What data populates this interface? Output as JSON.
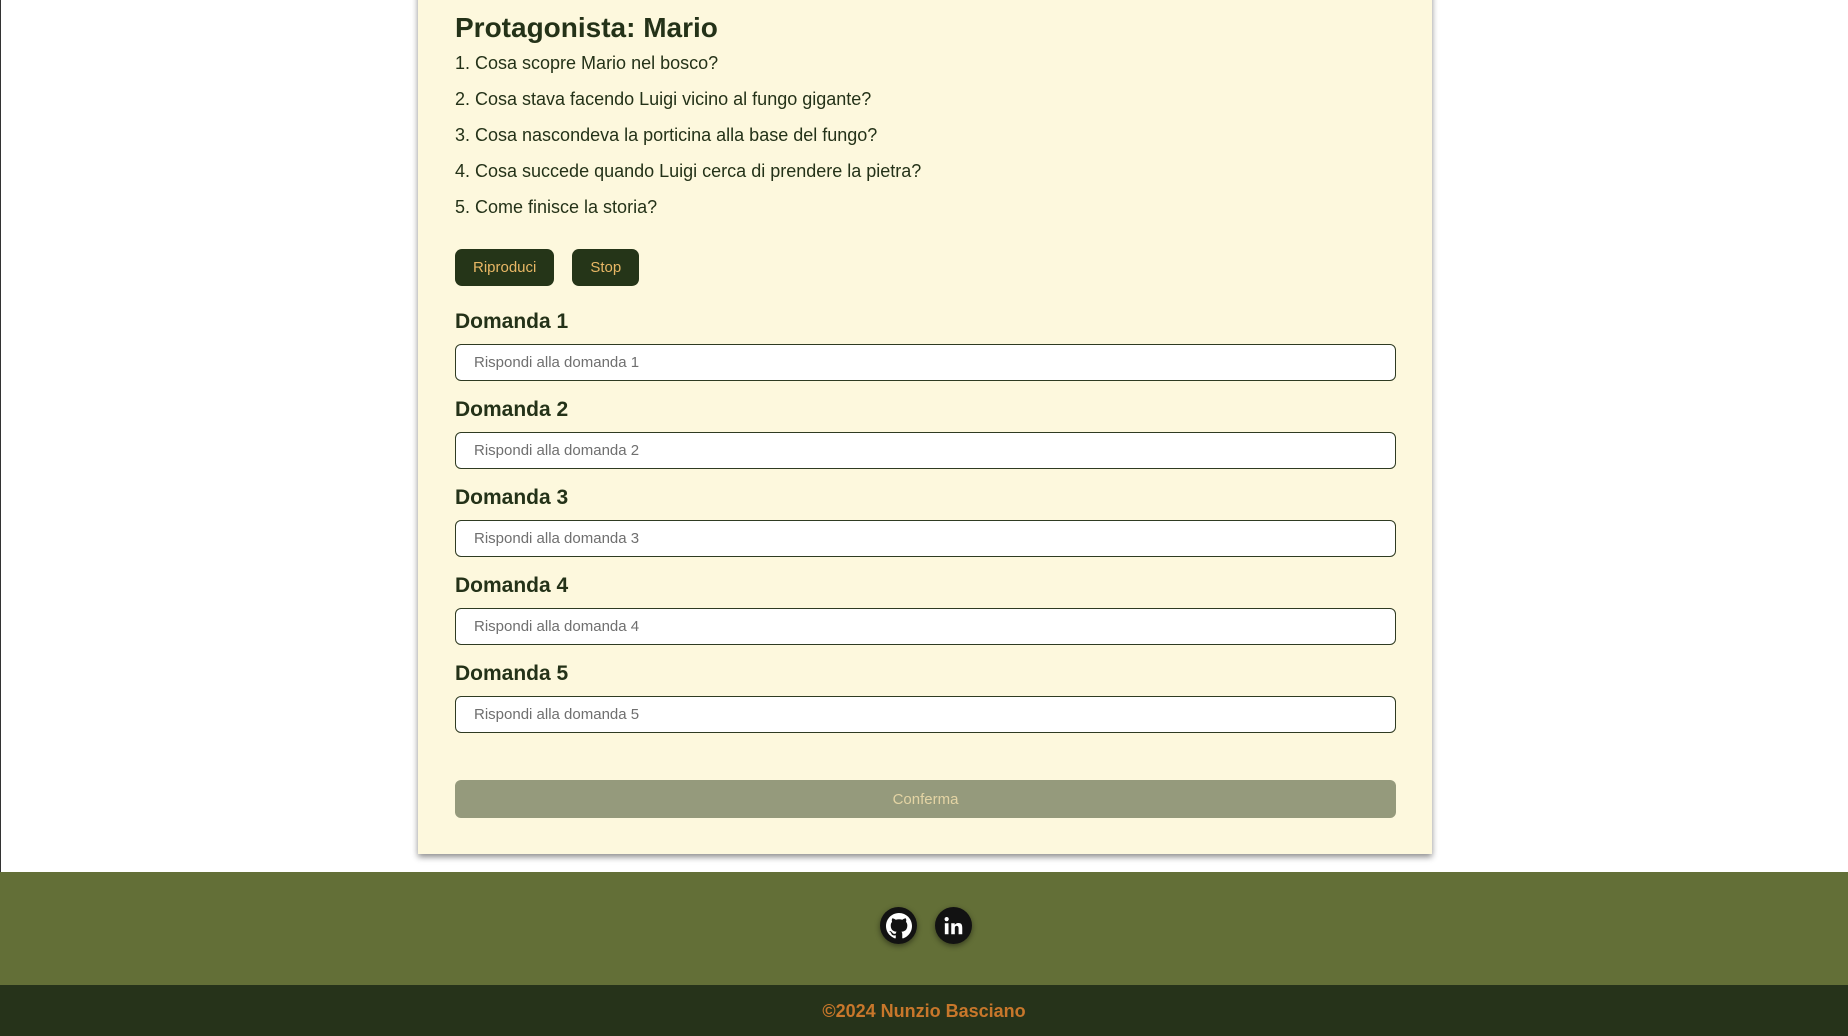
{
  "story": {
    "title": "Protagonista: Mario",
    "questions": [
      "1. Cosa scopre Mario nel bosco?",
      "2. Cosa stava facendo Luigi vicino al fungo gigante?",
      "3. Cosa nascondeva la porticina alla base del fungo?",
      "4. Cosa succede quando Luigi cerca di prendere la pietra?",
      "5. Come finisce la storia?"
    ],
    "play_label": "Riproduci",
    "stop_label": "Stop"
  },
  "answers": [
    {
      "label": "Domanda 1",
      "placeholder": "Rispondi alla domanda 1",
      "value": ""
    },
    {
      "label": "Domanda 2",
      "placeholder": "Rispondi alla domanda 2",
      "value": ""
    },
    {
      "label": "Domanda 3",
      "placeholder": "Rispondi alla domanda 3",
      "value": ""
    },
    {
      "label": "Domanda 4",
      "placeholder": "Rispondi alla domanda 4",
      "value": ""
    },
    {
      "label": "Domanda 5",
      "placeholder": "Rispondi alla domanda 5",
      "value": ""
    }
  ],
  "confirm_label": "Conferma",
  "footer": {
    "social": [
      {
        "icon": "github-icon"
      },
      {
        "icon": "linkedin-icon"
      }
    ],
    "copyright": "©2024 Nunzio Basciano"
  },
  "colors": {
    "card_bg": "#fdf8dd",
    "primary_dark": "#253518",
    "button_text": "#e8b765",
    "confirm_disabled": "#959a7c",
    "footer_top": "#636f37",
    "footer_bottom": "#26331a",
    "copyright_text": "#c8772b"
  }
}
